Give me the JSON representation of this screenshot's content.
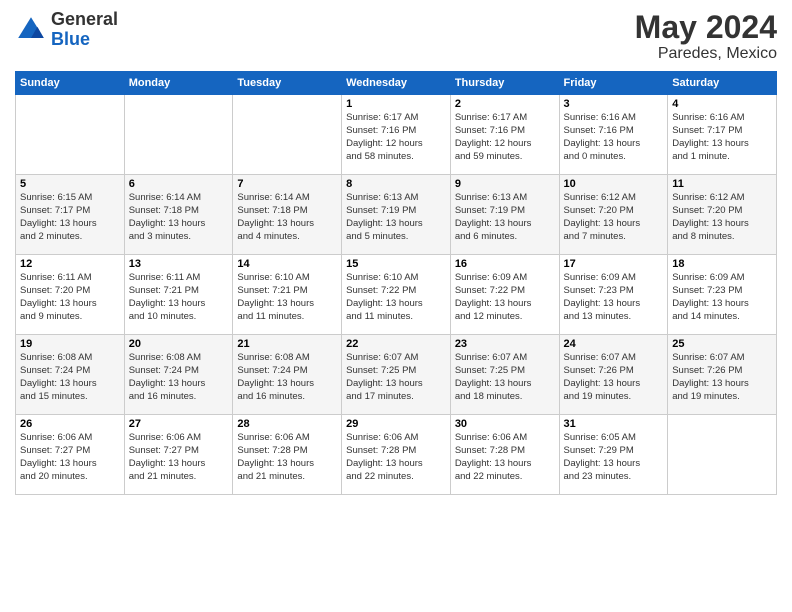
{
  "header": {
    "logo_general": "General",
    "logo_blue": "Blue",
    "month": "May 2024",
    "location": "Paredes, Mexico"
  },
  "weekdays": [
    "Sunday",
    "Monday",
    "Tuesday",
    "Wednesday",
    "Thursday",
    "Friday",
    "Saturday"
  ],
  "weeks": [
    [
      {
        "day": "",
        "info": ""
      },
      {
        "day": "",
        "info": ""
      },
      {
        "day": "",
        "info": ""
      },
      {
        "day": "1",
        "info": "Sunrise: 6:17 AM\nSunset: 7:16 PM\nDaylight: 12 hours\nand 58 minutes."
      },
      {
        "day": "2",
        "info": "Sunrise: 6:17 AM\nSunset: 7:16 PM\nDaylight: 12 hours\nand 59 minutes."
      },
      {
        "day": "3",
        "info": "Sunrise: 6:16 AM\nSunset: 7:16 PM\nDaylight: 13 hours\nand 0 minutes."
      },
      {
        "day": "4",
        "info": "Sunrise: 6:16 AM\nSunset: 7:17 PM\nDaylight: 13 hours\nand 1 minute."
      }
    ],
    [
      {
        "day": "5",
        "info": "Sunrise: 6:15 AM\nSunset: 7:17 PM\nDaylight: 13 hours\nand 2 minutes."
      },
      {
        "day": "6",
        "info": "Sunrise: 6:14 AM\nSunset: 7:18 PM\nDaylight: 13 hours\nand 3 minutes."
      },
      {
        "day": "7",
        "info": "Sunrise: 6:14 AM\nSunset: 7:18 PM\nDaylight: 13 hours\nand 4 minutes."
      },
      {
        "day": "8",
        "info": "Sunrise: 6:13 AM\nSunset: 7:19 PM\nDaylight: 13 hours\nand 5 minutes."
      },
      {
        "day": "9",
        "info": "Sunrise: 6:13 AM\nSunset: 7:19 PM\nDaylight: 13 hours\nand 6 minutes."
      },
      {
        "day": "10",
        "info": "Sunrise: 6:12 AM\nSunset: 7:20 PM\nDaylight: 13 hours\nand 7 minutes."
      },
      {
        "day": "11",
        "info": "Sunrise: 6:12 AM\nSunset: 7:20 PM\nDaylight: 13 hours\nand 8 minutes."
      }
    ],
    [
      {
        "day": "12",
        "info": "Sunrise: 6:11 AM\nSunset: 7:20 PM\nDaylight: 13 hours\nand 9 minutes."
      },
      {
        "day": "13",
        "info": "Sunrise: 6:11 AM\nSunset: 7:21 PM\nDaylight: 13 hours\nand 10 minutes."
      },
      {
        "day": "14",
        "info": "Sunrise: 6:10 AM\nSunset: 7:21 PM\nDaylight: 13 hours\nand 11 minutes."
      },
      {
        "day": "15",
        "info": "Sunrise: 6:10 AM\nSunset: 7:22 PM\nDaylight: 13 hours\nand 11 minutes."
      },
      {
        "day": "16",
        "info": "Sunrise: 6:09 AM\nSunset: 7:22 PM\nDaylight: 13 hours\nand 12 minutes."
      },
      {
        "day": "17",
        "info": "Sunrise: 6:09 AM\nSunset: 7:23 PM\nDaylight: 13 hours\nand 13 minutes."
      },
      {
        "day": "18",
        "info": "Sunrise: 6:09 AM\nSunset: 7:23 PM\nDaylight: 13 hours\nand 14 minutes."
      }
    ],
    [
      {
        "day": "19",
        "info": "Sunrise: 6:08 AM\nSunset: 7:24 PM\nDaylight: 13 hours\nand 15 minutes."
      },
      {
        "day": "20",
        "info": "Sunrise: 6:08 AM\nSunset: 7:24 PM\nDaylight: 13 hours\nand 16 minutes."
      },
      {
        "day": "21",
        "info": "Sunrise: 6:08 AM\nSunset: 7:24 PM\nDaylight: 13 hours\nand 16 minutes."
      },
      {
        "day": "22",
        "info": "Sunrise: 6:07 AM\nSunset: 7:25 PM\nDaylight: 13 hours\nand 17 minutes."
      },
      {
        "day": "23",
        "info": "Sunrise: 6:07 AM\nSunset: 7:25 PM\nDaylight: 13 hours\nand 18 minutes."
      },
      {
        "day": "24",
        "info": "Sunrise: 6:07 AM\nSunset: 7:26 PM\nDaylight: 13 hours\nand 19 minutes."
      },
      {
        "day": "25",
        "info": "Sunrise: 6:07 AM\nSunset: 7:26 PM\nDaylight: 13 hours\nand 19 minutes."
      }
    ],
    [
      {
        "day": "26",
        "info": "Sunrise: 6:06 AM\nSunset: 7:27 PM\nDaylight: 13 hours\nand 20 minutes."
      },
      {
        "day": "27",
        "info": "Sunrise: 6:06 AM\nSunset: 7:27 PM\nDaylight: 13 hours\nand 21 minutes."
      },
      {
        "day": "28",
        "info": "Sunrise: 6:06 AM\nSunset: 7:28 PM\nDaylight: 13 hours\nand 21 minutes."
      },
      {
        "day": "29",
        "info": "Sunrise: 6:06 AM\nSunset: 7:28 PM\nDaylight: 13 hours\nand 22 minutes."
      },
      {
        "day": "30",
        "info": "Sunrise: 6:06 AM\nSunset: 7:28 PM\nDaylight: 13 hours\nand 22 minutes."
      },
      {
        "day": "31",
        "info": "Sunrise: 6:05 AM\nSunset: 7:29 PM\nDaylight: 13 hours\nand 23 minutes."
      },
      {
        "day": "",
        "info": ""
      }
    ]
  ]
}
